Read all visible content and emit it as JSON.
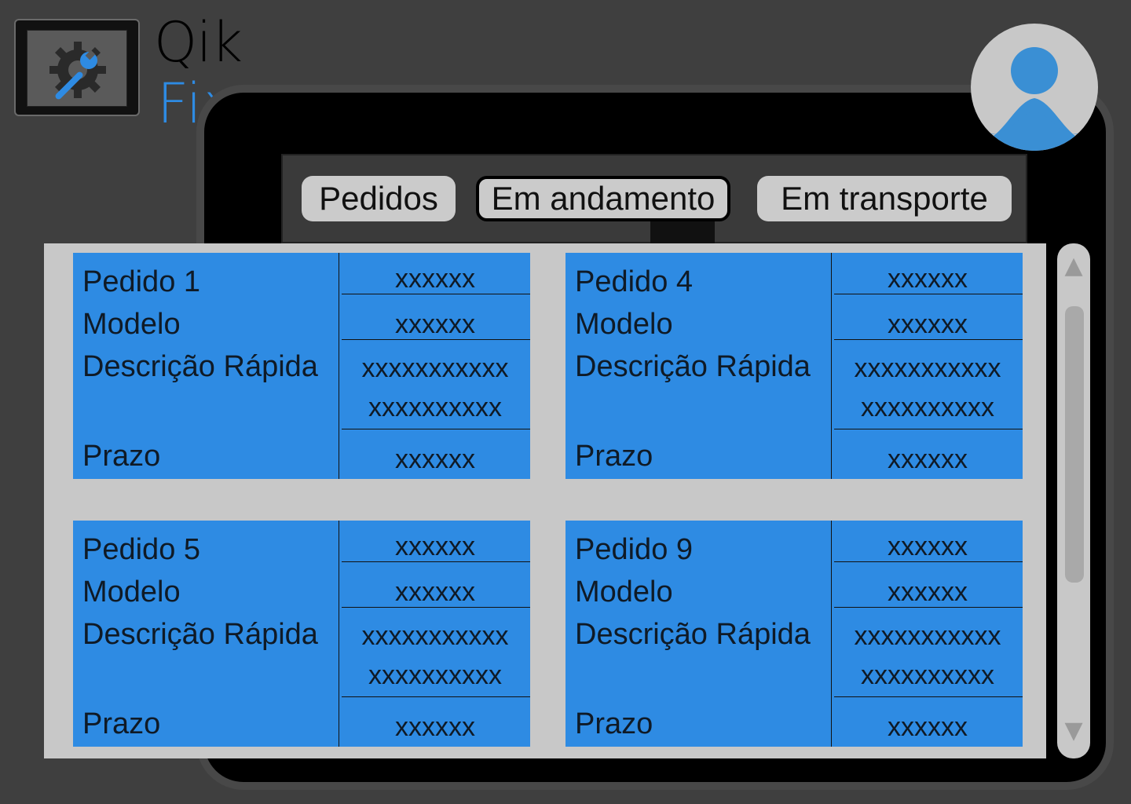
{
  "logo": {
    "line1": "Qik",
    "line2": "Fix",
    "icon": "gear-wrench-icon",
    "accent": "#2e8be3"
  },
  "tabs": [
    {
      "label": "Pedidos",
      "selected": false
    },
    {
      "label": "Em andamento",
      "selected": true
    },
    {
      "label": "Em transporte",
      "selected": false
    }
  ],
  "cards": [
    {
      "title": "Pedido 1",
      "model_label": "Modelo",
      "desc_label": "Descrição Rápida",
      "deadline_label": "Prazo",
      "title_value": "xxxxxx",
      "model_value": "xxxxxx",
      "desc_line1": "xxxxxxxxxxx",
      "desc_line2": "xxxxxxxxxx",
      "deadline_value": "xxxxxx"
    },
    {
      "title": "Pedido 4",
      "model_label": "Modelo",
      "desc_label": "Descrição Rápida",
      "deadline_label": "Prazo",
      "title_value": "xxxxxx",
      "model_value": "xxxxxx",
      "desc_line1": "xxxxxxxxxxx",
      "desc_line2": "xxxxxxxxxx",
      "deadline_value": "xxxxxx"
    },
    {
      "title": "Pedido 5",
      "model_label": "Modelo",
      "desc_label": "Descrição Rápida",
      "deadline_label": "Prazo",
      "title_value": "xxxxxx",
      "model_value": "xxxxxx",
      "desc_line1": "xxxxxxxxxxx",
      "desc_line2": "xxxxxxxxxx",
      "deadline_value": "xxxxxx"
    },
    {
      "title": "Pedido 9",
      "model_label": "Modelo",
      "desc_label": "Descrição Rápida",
      "deadline_label": "Prazo",
      "title_value": "xxxxxx",
      "model_value": "xxxxxx",
      "desc_line1": "xxxxxxxxxxx",
      "desc_line2": "xxxxxxxxxx",
      "deadline_value": "xxxxxx"
    }
  ],
  "scrollbar": {
    "up_icon": "arrow-up-icon",
    "down_icon": "arrow-down-icon"
  },
  "avatar": {
    "icon": "user-avatar-icon",
    "color": "#3a8fd4"
  }
}
